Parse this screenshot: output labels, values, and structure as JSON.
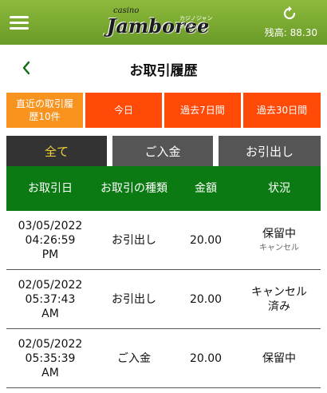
{
  "topbar": {
    "logo_small": "casino",
    "logo_main": "Jamboree",
    "logo_sub": "カジノジャンボリー",
    "balance": "残高: 88.30",
    "icons": {
      "menu": "hamburger-menu-icon",
      "refresh": "refresh-icon"
    }
  },
  "page": {
    "title": "お取引履歴",
    "back_icon": "chevron-left-icon"
  },
  "filters": [
    {
      "label": "直近の取引履歴10件",
      "active": true
    },
    {
      "label": "今日",
      "active": false
    },
    {
      "label": "過去7日間",
      "active": false
    },
    {
      "label": "過去30日間",
      "active": false
    }
  ],
  "tabs": [
    {
      "label": "全て",
      "active": true
    },
    {
      "label": "ご入金",
      "active": false
    },
    {
      "label": "お引出し",
      "active": false
    }
  ],
  "table": {
    "headers": [
      "お取引日",
      "お取引の種類",
      "金額",
      "状況"
    ],
    "rows": [
      {
        "date": "03/05/2022 04:26:59 PM",
        "type": "お引出し",
        "amount": "20.00",
        "status": "保留中",
        "action": "キャンセル"
      },
      {
        "date": "02/05/2022 05:37:43 AM",
        "type": "お引出し",
        "amount": "20.00",
        "status": "キャンセル済み",
        "action": ""
      },
      {
        "date": "02/05/2022 05:35:39 AM",
        "type": "ご入金",
        "amount": "20.00",
        "status": "保留中",
        "action": ""
      }
    ]
  },
  "colors": {
    "topbar": "#7aa830",
    "filter_active": "#f7931e",
    "filter": "#ff4a08",
    "tab_active_text": "#f3d23b",
    "table_header": "#0b7a12"
  }
}
